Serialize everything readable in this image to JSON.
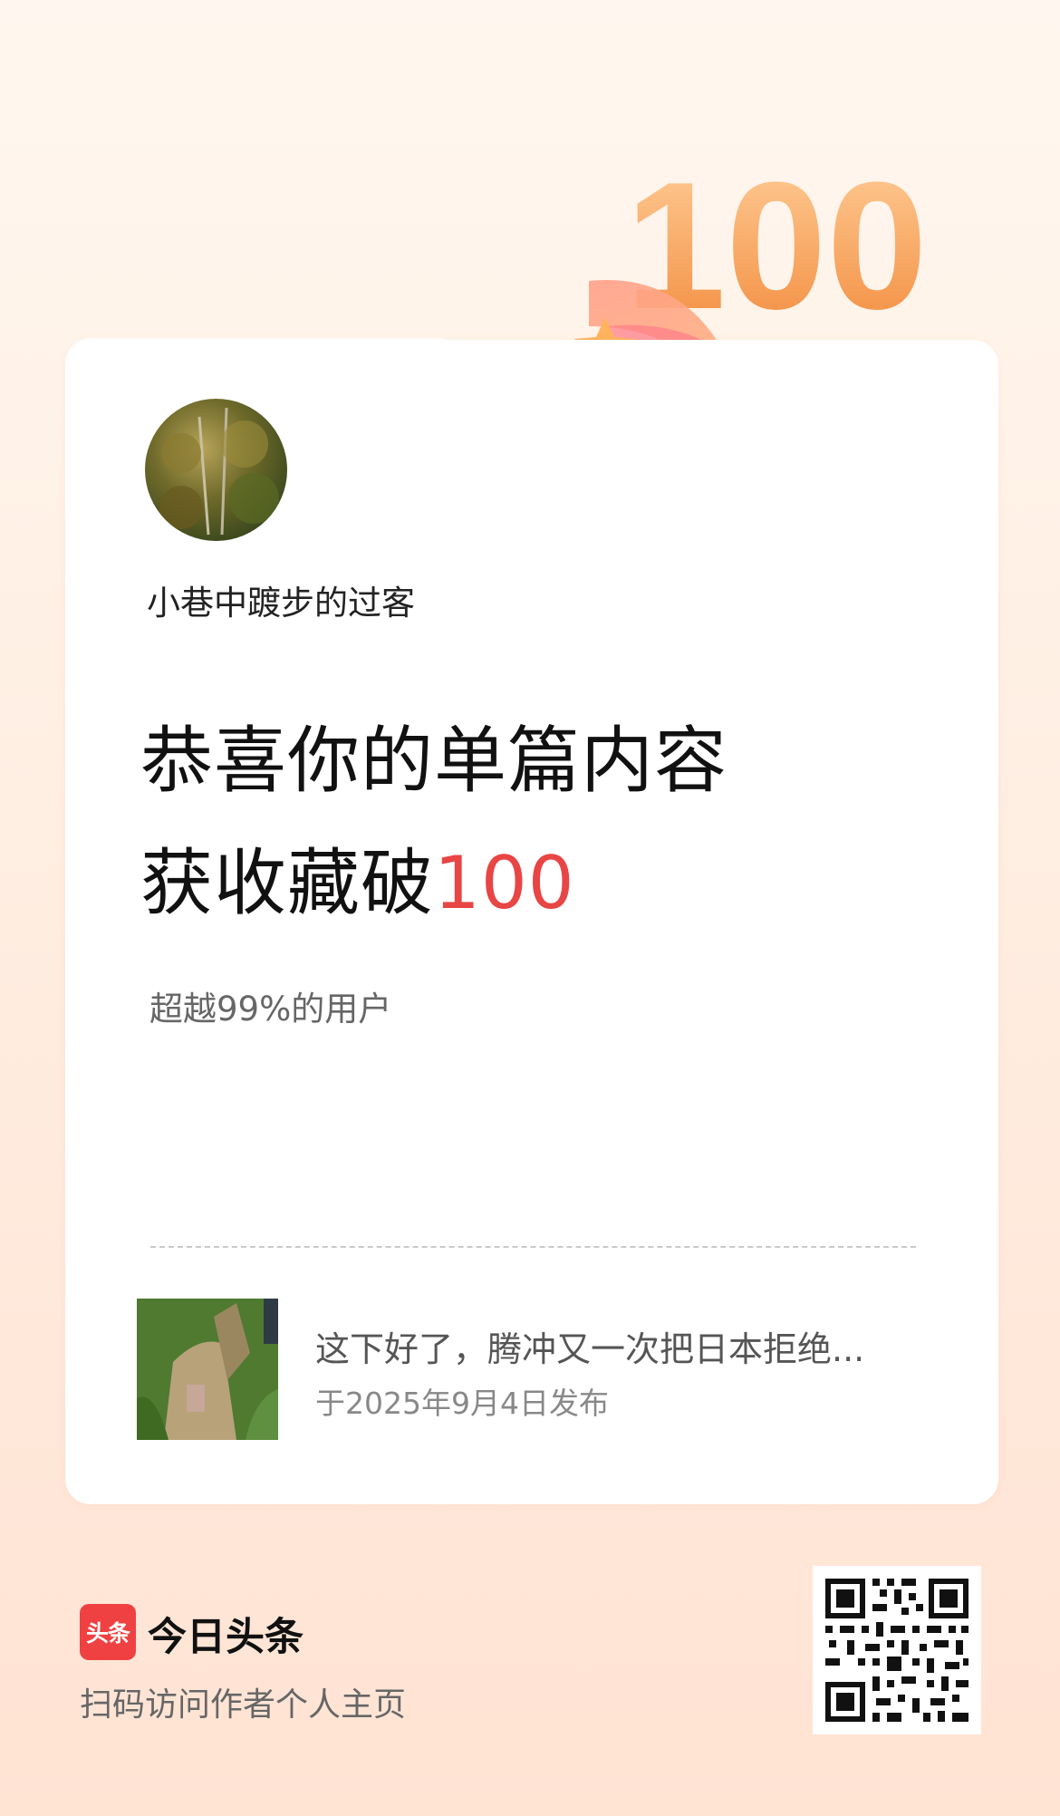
{
  "badge": {
    "number": "100",
    "colors": {
      "number": "#f5a15a",
      "ribbon": "#ff8a7a",
      "star": "#ffb35c"
    }
  },
  "profile": {
    "username": "小巷中踱步的过客"
  },
  "achievement": {
    "headline_line1": "恭喜你的单篇内容",
    "headline_line2_prefix": "获收藏破",
    "headline_line2_value": "100",
    "subtitle": "超越99%的用户",
    "highlight_color": "#e84545"
  },
  "article": {
    "title": "这下好了，腾冲又一次把日本拒绝...",
    "date": "于2025年9月4日发布"
  },
  "footer": {
    "logo_text": "头条",
    "app_name": "今日头条",
    "description": "扫码访问作者个人主页",
    "logo_color": "#f04142"
  }
}
